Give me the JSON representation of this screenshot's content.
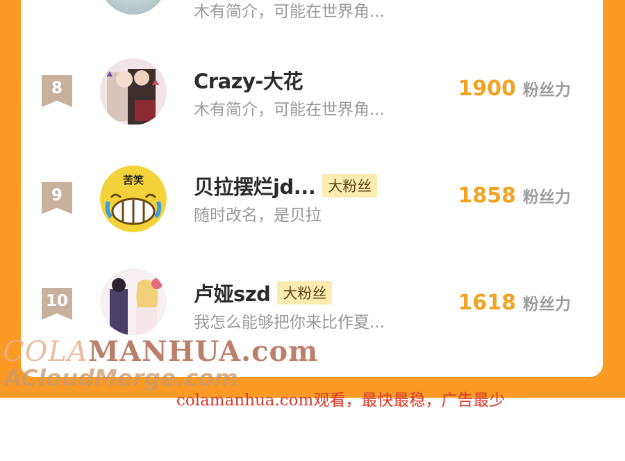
{
  "ranking": {
    "top_partial": {
      "desc": "木有简介，可能在世界角..."
    },
    "rows": [
      {
        "rank": "8",
        "name": "Crazy-大花",
        "badge": "",
        "desc": "木有简介，可能在世界角...",
        "score": "1900",
        "unit": "粉丝力"
      },
      {
        "rank": "9",
        "name": "贝拉摆烂jd...",
        "badge": "大粉丝",
        "desc": "随时改名，是贝拉",
        "score": "1858",
        "unit": "粉丝力"
      },
      {
        "rank": "10",
        "name": "卢娅szd",
        "badge": "大粉丝",
        "desc": "我怎么能够把你来比作夏...",
        "score": "1618",
        "unit": "粉丝力"
      }
    ],
    "avatar_9_text": "苦笑"
  },
  "watermarks": {
    "line1_a": "COLA",
    "line1_b": "MANHUA.com",
    "line2": "ACloudMerge.com",
    "ad_text": "colamanhua.com观看，最快最稳，广告最少"
  },
  "colors": {
    "frame": "#fb9a24",
    "score": "#f2a322",
    "badge_bg": "#fdecb0",
    "rank_bg": "#c8b19c"
  }
}
